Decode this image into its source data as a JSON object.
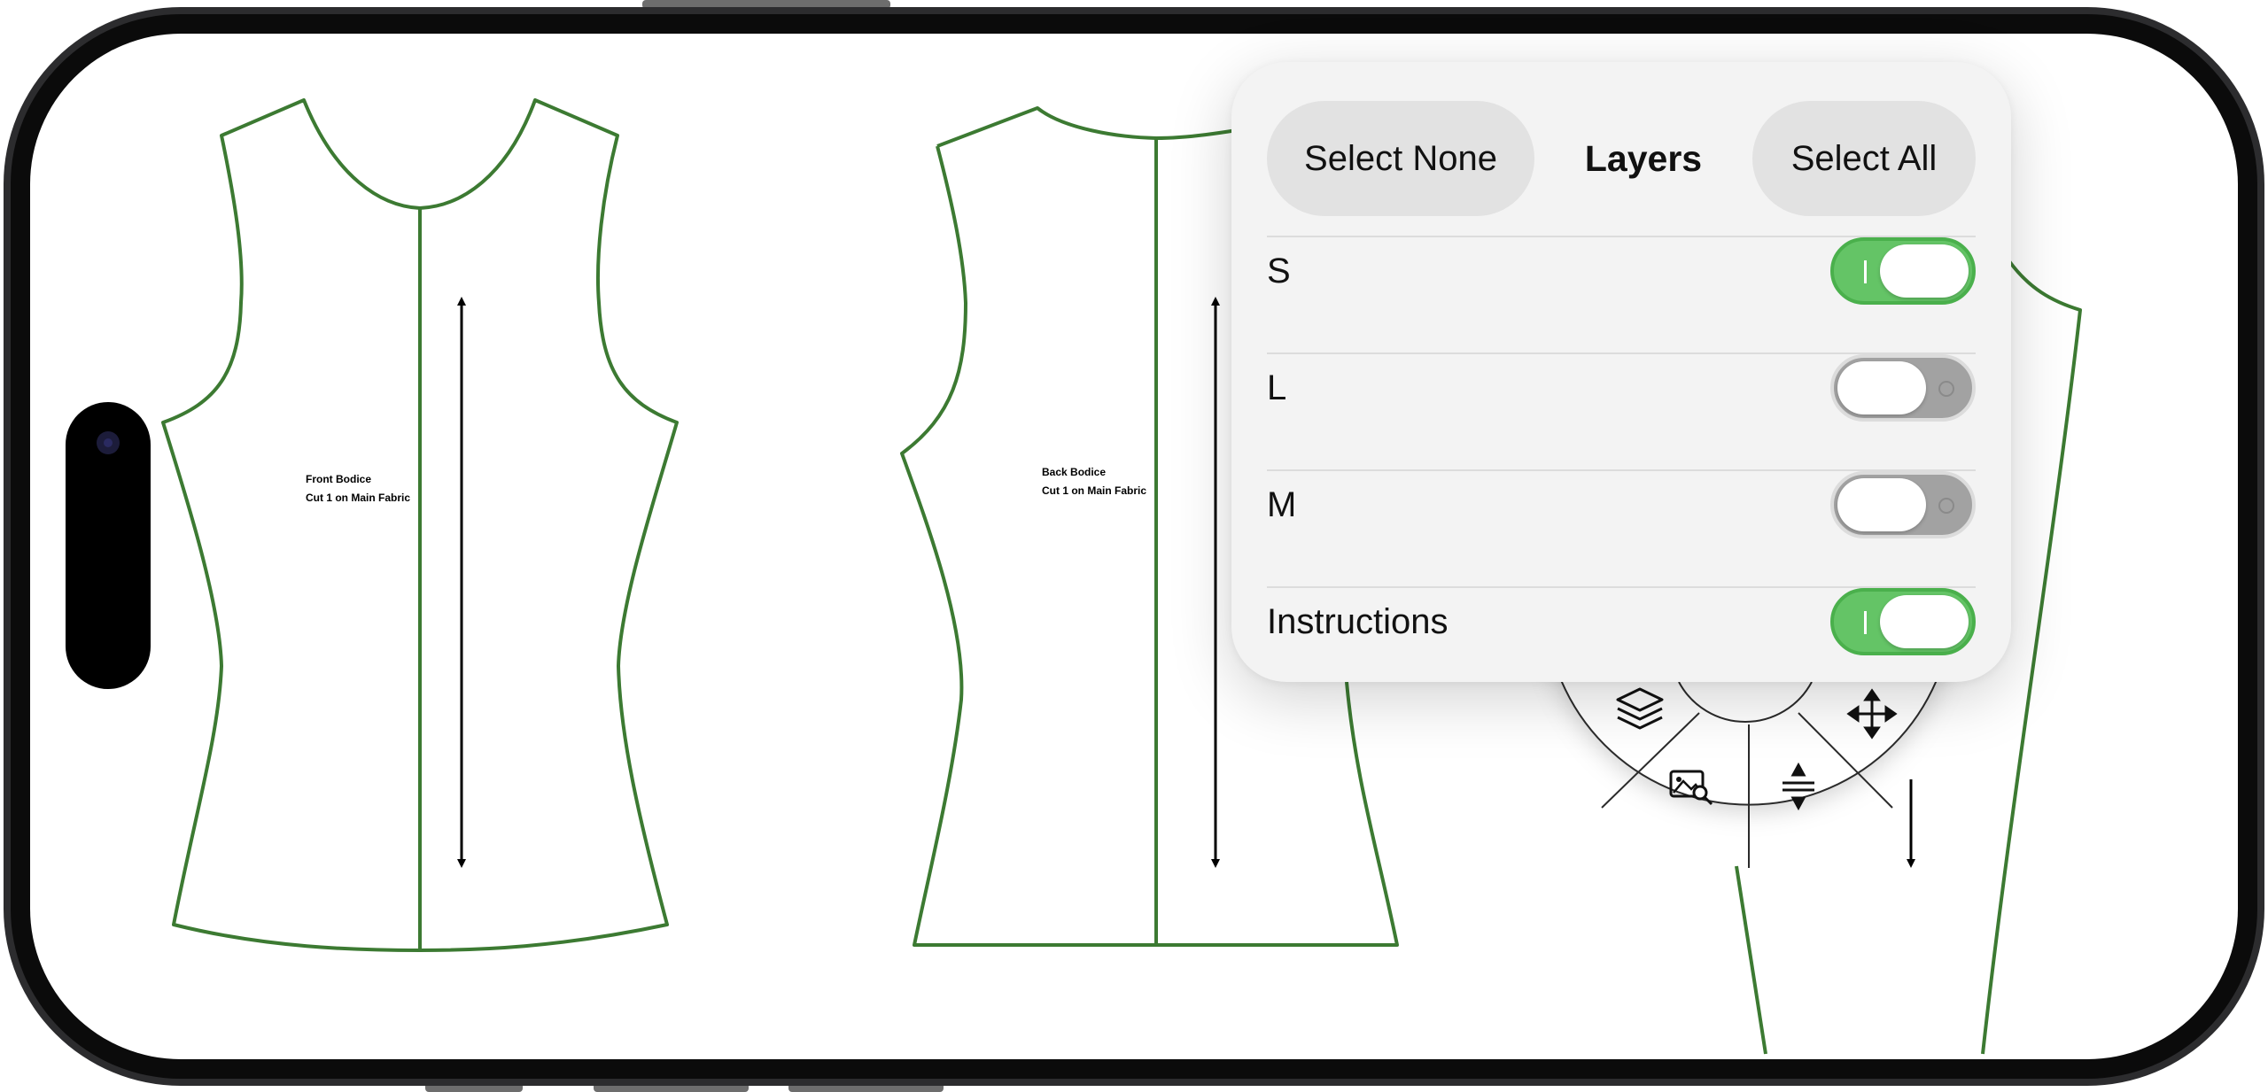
{
  "layers_panel": {
    "title": "Layers",
    "select_none_label": "Select None",
    "select_all_label": "Select All",
    "items": [
      {
        "label": "S",
        "enabled": true
      },
      {
        "label": "L",
        "enabled": false
      },
      {
        "label": "M",
        "enabled": false
      },
      {
        "label": "Instructions",
        "enabled": true
      }
    ]
  },
  "pattern_pieces": [
    {
      "line1": "Front Bodice",
      "line2": "Cut 1 on Main Fabric"
    },
    {
      "line1": "Back Bodice",
      "line2": "Cut 1 on Main Fabric"
    }
  ],
  "radial_menu": {
    "icons": [
      "layers-icon",
      "move-icon",
      "image-search-icon",
      "adjust-spacing-icon"
    ]
  },
  "colors": {
    "pattern_line": "#3c7a32",
    "toggle_on": "#64c466",
    "toggle_off": "#a2a2a2",
    "phone_frame": "#1a1a1a"
  }
}
